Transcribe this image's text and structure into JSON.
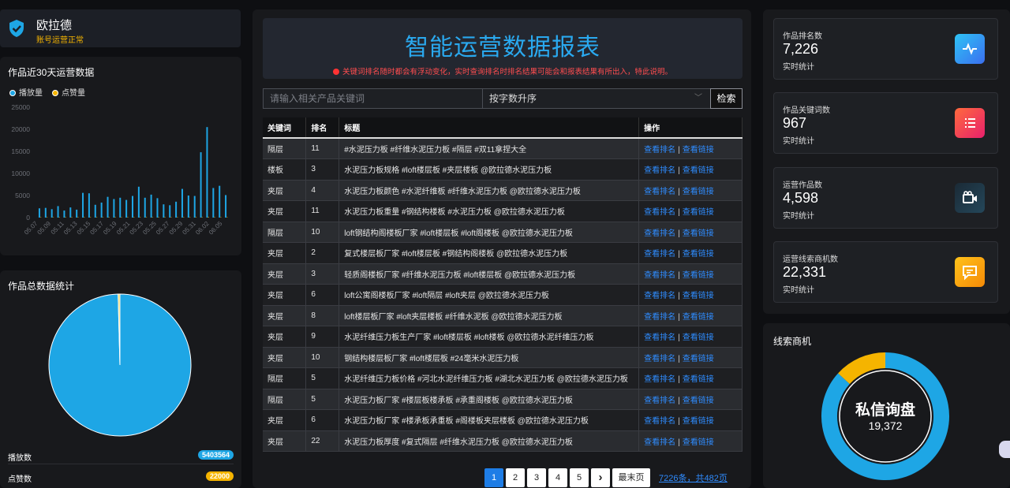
{
  "account": {
    "name": "欧拉德",
    "status": "账号运营正常"
  },
  "bar_panel": {
    "title": "作品近30天运营数据"
  },
  "pie_panel": {
    "title": "作品总数据统计"
  },
  "stats": [
    {
      "label": "播放数",
      "value": "5403564",
      "color": "#1ea6e5"
    },
    {
      "label": "点赞数",
      "value": "22000",
      "color": "#f5b400"
    }
  ],
  "chart_data": [
    {
      "type": "bar",
      "legend": [
        {
          "name": "播放量",
          "color": "#1ea6e5"
        },
        {
          "name": "点赞量",
          "color": "#f5b400"
        }
      ],
      "ylim": [
        0,
        25000
      ],
      "yticks": [
        "0",
        "5000",
        "10000",
        "15000",
        "20000",
        "25000"
      ],
      "x_labels": [
        "05.07",
        "05.09",
        "05.11",
        "05.13",
        "05.15",
        "05.17",
        "05.19",
        "05.21",
        "05.23",
        "05.25",
        "05.27",
        "05.29",
        "05.31",
        "06.02",
        "06.05"
      ],
      "series": [
        {
          "name": "播放量",
          "values": [
            2100,
            2200,
            1900,
            2600,
            1600,
            2300,
            1800,
            5600,
            5500,
            2900,
            3400,
            4700,
            4200,
            4500,
            4000,
            4900,
            7000,
            4500,
            5200,
            4400,
            3000,
            2800,
            3600,
            6500,
            5000,
            4900,
            14800,
            20500,
            6700,
            7200,
            5100
          ]
        },
        {
          "name": "点赞量",
          "values": [
            20,
            15,
            10,
            25,
            12,
            18,
            14,
            40,
            38,
            22,
            30,
            35,
            28,
            33,
            25,
            36,
            50,
            32,
            37,
            30,
            20,
            18,
            26,
            45,
            35,
            33,
            90,
            120,
            48,
            52,
            36
          ]
        }
      ]
    },
    {
      "type": "pie",
      "slices": [
        {
          "label": "播放数",
          "value": 5403564,
          "color": "#1ea6e5"
        },
        {
          "label": "点赞数",
          "value": 22000,
          "color": "#f5d23c"
        }
      ]
    },
    {
      "type": "pie",
      "title": "线索商机",
      "center_label": "私信询盘",
      "center_value": "19,372",
      "slices": [
        {
          "label": "私信询盘",
          "value": 19372,
          "color": "#1ea6e5"
        },
        {
          "label": "other",
          "value": 2959,
          "color": "#f5b400"
        }
      ]
    }
  ],
  "banner": {
    "title": "智能运营数据报表",
    "note": "关键词排名随时都会有浮动变化，实时查询排名时排名结果可能会和报表结果有所出入，特此说明。"
  },
  "search": {
    "placeholder": "请输入相关产品关键词",
    "sort_value": "按字数升序",
    "button": "检索"
  },
  "table": {
    "headers": [
      "关键词",
      "排名",
      "标题",
      "操作"
    ],
    "link_rank": "查看排名",
    "link_url": "查看链接",
    "rows": [
      {
        "kw": "隔层",
        "rank": "11",
        "title": "#水泥压力板 #纤维水泥压力板 #隔层 #双11拿捏大全"
      },
      {
        "kw": "楼板",
        "rank": "3",
        "title": "水泥压力板规格 #loft楼层板 #夹层楼板 @欧拉德水泥压力板"
      },
      {
        "kw": "夹层",
        "rank": "4",
        "title": "水泥压力板颜色 #水泥纤维板 #纤维水泥压力板 @欧拉德水泥压力板"
      },
      {
        "kw": "夹层",
        "rank": "11",
        "title": "水泥压力板重量 #钢结构楼板 #水泥压力板 @欧拉德水泥压力板"
      },
      {
        "kw": "隔层",
        "rank": "10",
        "title": "loft钢结构阁楼板厂家 #loft楼层板 #loft阁楼板 @欧拉德水泥压力板"
      },
      {
        "kw": "夹层",
        "rank": "2",
        "title": "复式楼层板厂家 #loft楼层板 #钢结构阁楼板 @欧拉德水泥压力板"
      },
      {
        "kw": "夹层",
        "rank": "3",
        "title": "轻质阁楼板厂家 #纤维水泥压力板 #loft楼层板 @欧拉德水泥压力板"
      },
      {
        "kw": "夹层",
        "rank": "6",
        "title": "loft公寓阁楼板厂家 #loft隔层 #loft夹层 @欧拉德水泥压力板"
      },
      {
        "kw": "夹层",
        "rank": "8",
        "title": "loft楼层板厂家 #loft夹层楼板 #纤维水泥板 @欧拉德水泥压力板"
      },
      {
        "kw": "夹层",
        "rank": "9",
        "title": "水泥纤维压力板生产厂家 #loft楼层板 #loft楼板 @欧拉德水泥纤维压力板"
      },
      {
        "kw": "夹层",
        "rank": "10",
        "title": "钢结构楼层板厂家 #loft楼层板 #24毫米水泥压力板"
      },
      {
        "kw": "隔层",
        "rank": "5",
        "title": "水泥纤维压力板价格 #河北水泥纤维压力板 #湖北水泥压力板 @欧拉德水泥压力板"
      },
      {
        "kw": "隔层",
        "rank": "5",
        "title": "水泥压力板厂家 #楼层板楼承板 #承重阁楼板 @欧拉德水泥压力板"
      },
      {
        "kw": "夹层",
        "rank": "6",
        "title": "水泥压力板厂家 #楼承板承重板 #阁楼板夹层楼板 @欧拉德水泥压力板"
      },
      {
        "kw": "夹层",
        "rank": "22",
        "title": "水泥压力板厚度 #复式隔层 #纤维水泥压力板 @欧拉德水泥压力板"
      }
    ]
  },
  "pager": {
    "pages": [
      "1",
      "2",
      "3",
      "4",
      "5"
    ],
    "next": "›",
    "last": "最末页",
    "total": "7226条，共482页"
  },
  "cards": [
    {
      "label": "作品排名数",
      "value": "7,226",
      "sub": "实时统计",
      "icon": "activity-icon",
      "colors": [
        "#2ec3f5",
        "#3b6ff0"
      ]
    },
    {
      "label": "作品关键词数",
      "value": "967",
      "sub": "实时统计",
      "icon": "list-icon",
      "colors": [
        "#ff6a3d",
        "#e8206c"
      ]
    },
    {
      "label": "运营作品数",
      "value": "4,598",
      "sub": "实时统计",
      "icon": "video-icon",
      "colors": [
        "#1b2a36",
        "#24475a"
      ]
    },
    {
      "label": "运营线索商机数",
      "value": "22,331",
      "sub": "实时统计",
      "icon": "message-icon",
      "colors": [
        "#ffc21a",
        "#f58a07"
      ]
    }
  ],
  "lead_panel": {
    "title": "线索商机"
  }
}
